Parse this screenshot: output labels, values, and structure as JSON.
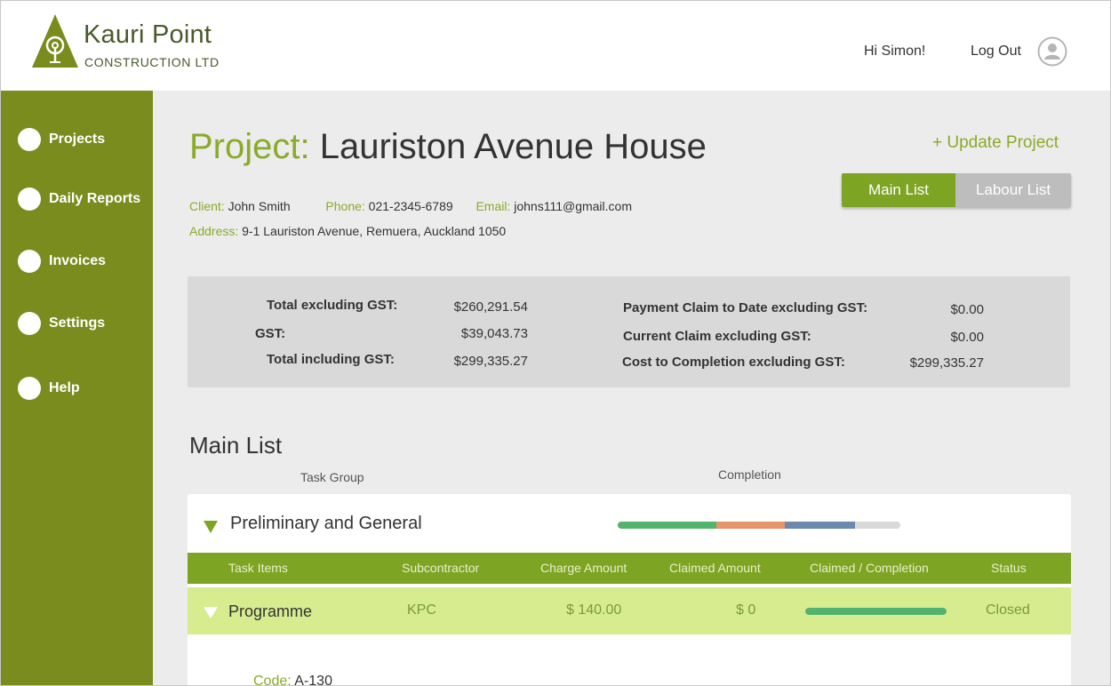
{
  "header": {
    "brand_name": "Kauri Point",
    "brand_sub": "CONSTRUCTION LTD",
    "greeting": "Hi  Simon!",
    "logout_label": "Log Out"
  },
  "sidebar": {
    "items": [
      {
        "label": "Projects"
      },
      {
        "label": "Daily Reports"
      },
      {
        "label": "Invoices"
      },
      {
        "label": "Settings"
      },
      {
        "label": "Help"
      }
    ]
  },
  "project": {
    "title_prefix": "Project:",
    "title_name": " Lauriston Avenue House",
    "update_label": "+ Update Project",
    "client_label": "Client:",
    "client": "John Smith",
    "phone_label": "Phone:",
    "phone": "021-2345-6789",
    "email_label": "Email:",
    "email": "johns111@gmail.com",
    "address_label": "Address:",
    "address": "9-1 Lauriston Avenue, Remuera, Auckland 1050"
  },
  "toggle": {
    "main_label": "Main List",
    "labour_label": "Labour List"
  },
  "summary": {
    "total_ex_label": "Total excluding GST:",
    "total_ex": "$260,291.54",
    "gst_label": "GST:",
    "gst": "$39,043.73",
    "total_inc_label": "Total including GST:",
    "total_inc": "$299,335.27",
    "claim_to_date_label": "Payment Claim to Date excluding GST:",
    "claim_to_date": "$0.00",
    "current_claim_label": "Current Claim excluding GST:",
    "current_claim": "$0.00",
    "cost_to_completion_label": "Cost to Completion excluding GST:",
    "cost_to_completion": "$299,335.27"
  },
  "main_list": {
    "title": "Main List",
    "task_group_caption": "Task Group",
    "completion_caption": "Completion",
    "group": {
      "name": "Preliminary and General",
      "progress_segments": [
        {
          "fraction": 0.35,
          "color": "#52b36e"
        },
        {
          "fraction": 0.24,
          "color": "#e8956a"
        },
        {
          "fraction": 0.25,
          "color": "#6a88b0"
        }
      ]
    },
    "columns": [
      "Task Items",
      "Subcontractor",
      "Charge Amount",
      "Claimed Amount",
      "Claimed / Completion",
      "Status"
    ],
    "task": {
      "name": "Programme",
      "subcontractor": "KPC",
      "charge": "$ 140.00",
      "claimed": "$ 0",
      "completion_fraction": 1.0,
      "status": "Closed"
    },
    "code_label": "Code:",
    "code": "A-130"
  },
  "colors": {
    "accent": "#8aaa2a",
    "sidebar": "#7a8c1e",
    "table_head": "#7ea424",
    "task_row": "#d7ec8f"
  }
}
